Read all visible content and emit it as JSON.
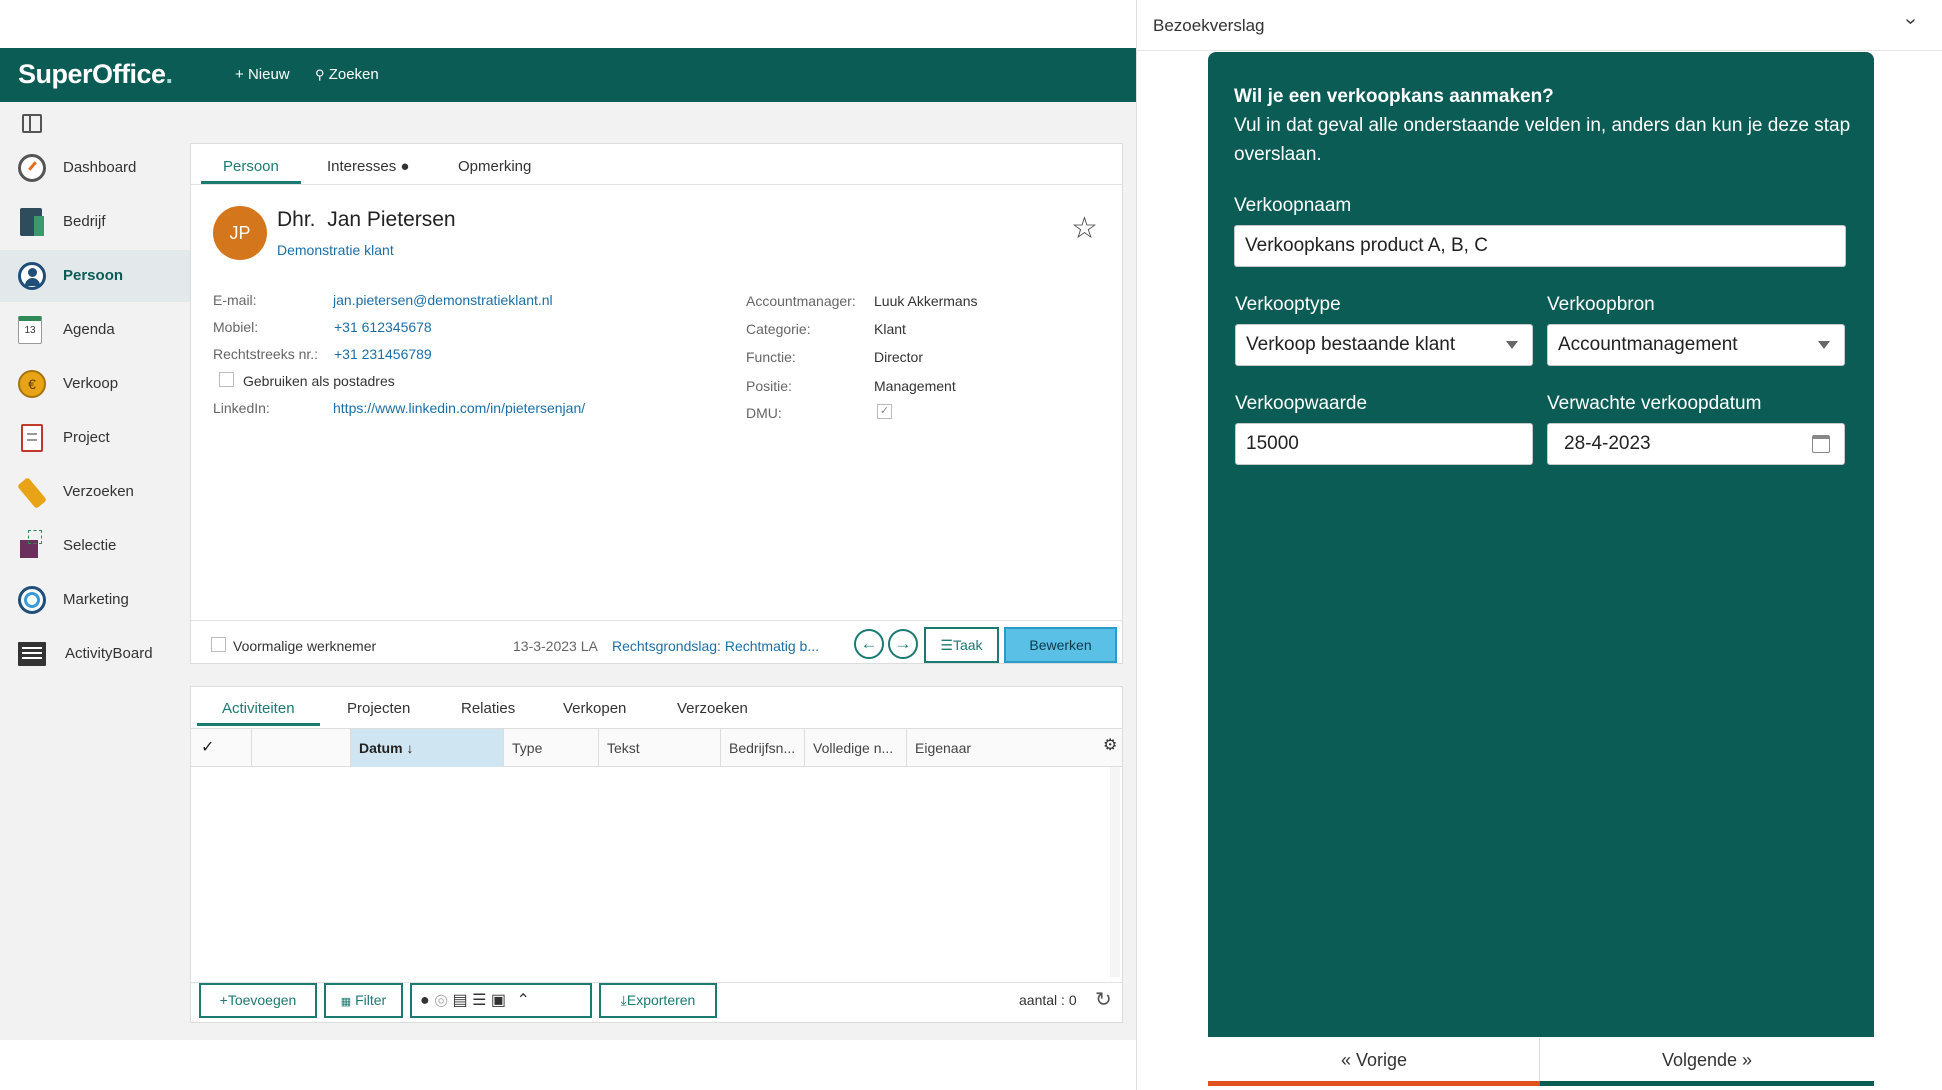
{
  "app": {
    "brand": "SuperOffice",
    "brand_dot": ".",
    "nav_new": "Nieuw",
    "nav_search": "Zoeken"
  },
  "sidebar": {
    "items": [
      {
        "label": "Dashboard",
        "icon": "gauge-icon"
      },
      {
        "label": "Bedrijf",
        "icon": "building-icon"
      },
      {
        "label": "Persoon",
        "icon": "person-icon"
      },
      {
        "label": "Agenda",
        "icon": "calendar-icon"
      },
      {
        "label": "Verkoop",
        "icon": "coin-icon"
      },
      {
        "label": "Project",
        "icon": "clipboard-icon"
      },
      {
        "label": "Verzoeken",
        "icon": "ticket-icon"
      },
      {
        "label": "Selectie",
        "icon": "selection-icon"
      },
      {
        "label": "Marketing",
        "icon": "target-icon"
      },
      {
        "label": "ActivityBoard",
        "icon": "board-icon"
      }
    ],
    "agenda_day": "13"
  },
  "person": {
    "tabs": [
      "Persoon",
      "Interesses ●",
      "Opmerking"
    ],
    "initials": "JP",
    "salutation": "Dhr.",
    "name": "Jan Pietersen",
    "company": "Demonstratie klant",
    "left_fields": {
      "email_label": "E-mail:",
      "email": "jan.pietersen@demonstratieklant.nl",
      "mobile_label": "Mobiel:",
      "mobile": "+31 612345678",
      "direct_label": "Rechtstreeks nr.:",
      "direct": "+31 231456789",
      "postal_checkbox": "Gebruiken als postadres",
      "linkedin_label": "LinkedIn:",
      "linkedin": "https://www.linkedin.com/in/pietersenjan/"
    },
    "right_fields": {
      "accountmanager_label": "Accountmanager:",
      "accountmanager": "Luuk Akkermans",
      "category_label": "Categorie:",
      "category": "Klant",
      "function_label": "Functie:",
      "function": "Director",
      "position_label": "Positie:",
      "position": "Management",
      "dmu_label": "DMU:"
    },
    "footer": {
      "former_employee": "Voormalige werknemer",
      "updated": "13-3-2023 LA",
      "legal_basis": "Rechtsgrondslag: Rechtmatig b...",
      "task_button": "Taak",
      "edit_button": "Bewerken"
    }
  },
  "activities": {
    "tabs": [
      "Activiteiten",
      "Projecten",
      "Relaties",
      "Verkopen",
      "Verzoeken"
    ],
    "columns": [
      "Datum ↓",
      "Type",
      "Tekst",
      "Bedrijfsn...",
      "Volledige n...",
      "Eigenaar"
    ],
    "add_button": "Toevoegen",
    "filter_button": "Filter",
    "export_button": "Exporteren",
    "count": "aantal : 0"
  },
  "right_panel": {
    "header": "Bezoekverslag",
    "intro_bold": "Wil je een verkoopkans aanmaken?",
    "intro_text": "Vul in dat geval alle onderstaande velden in, anders dan kun je deze stap overslaan.",
    "sale_name_label": "Verkoopnaam",
    "sale_name": "Verkoopkans product A, B, C",
    "sale_type_label": "Verkooptype",
    "sale_type": "Verkoop bestaande klant",
    "sale_source_label": "Verkoopbron",
    "sale_source": "Accountmanagement",
    "sale_value_label": "Verkoopwaarde",
    "sale_value": "15000",
    "expected_date_label": "Verwachte verkoopdatum",
    "expected_date": "28-4-2023",
    "prev_button": "Vorige",
    "next_button": "Volgende",
    "colors": {
      "panel": "#0b5c55",
      "prev_accent": "#e0531e",
      "next_accent": "#0b5c55"
    }
  }
}
